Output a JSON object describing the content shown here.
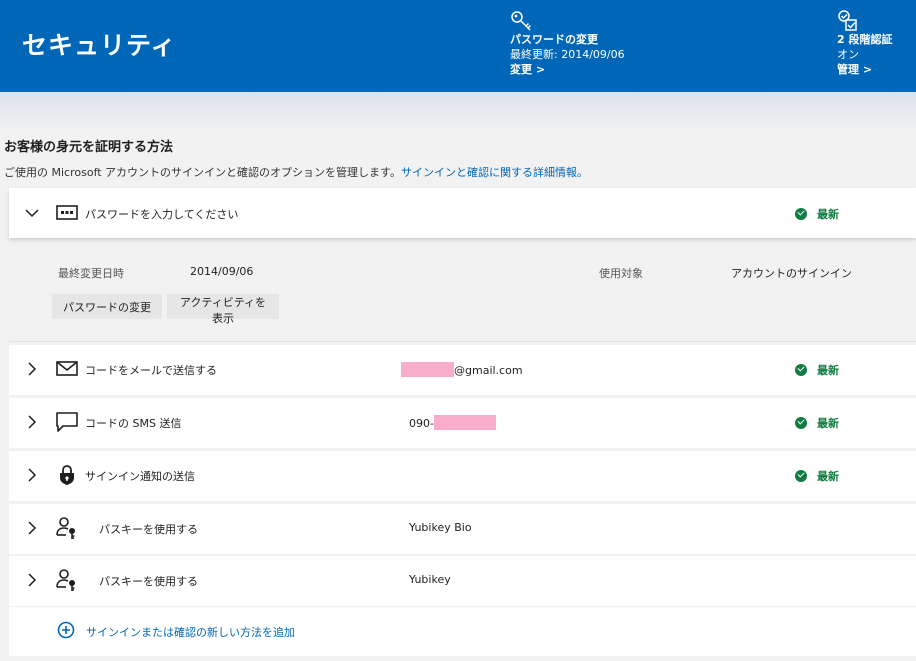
{
  "header": {
    "title": "セキュリティ",
    "password": {
      "title": "パスワードの変更",
      "subtitle": "最終更新: 2014/09/06",
      "link": "変更 >"
    },
    "two_step": {
      "title": "2 段階認証",
      "subtitle": "オン",
      "link": "管理 >"
    }
  },
  "section": {
    "title": "お客様の身元を証明する方法",
    "description": "ご使用の Microsoft アカウントのサインインと確認のオプションを管理します。",
    "description_link": "サインインと確認に関する詳細情報。"
  },
  "password_method": {
    "label": "パスワードを入力してください",
    "status": "最新",
    "details": {
      "last_changed_label": "最終変更日時",
      "last_changed_value": "2014/09/06",
      "used_for_label": "使用対象",
      "used_for_value": "アカウントのサインイン",
      "change_button": "パスワードの変更",
      "activity_button": "アクティビティを表示"
    }
  },
  "methods": {
    "email": {
      "label": "コードをメールで送信する",
      "value_suffix": "@gmail.com",
      "status": "最新"
    },
    "sms": {
      "label": "コードの SMS 送信",
      "value_prefix": "090-",
      "status": "最新"
    },
    "notify": {
      "label": "サインイン通知の送信",
      "status": "最新"
    },
    "passkey1": {
      "label": "パスキーを使用する",
      "value": "Yubikey Bio"
    },
    "passkey2": {
      "label": "パスキーを使用する",
      "value": "Yubikey"
    }
  },
  "add_method": {
    "label": "サインインまたは確認の新しい方法を追加"
  },
  "colors": {
    "header_bg": "#0067b8",
    "status_green": "#107c41",
    "link_blue": "#0067b8",
    "redaction": "#f8aecb"
  }
}
